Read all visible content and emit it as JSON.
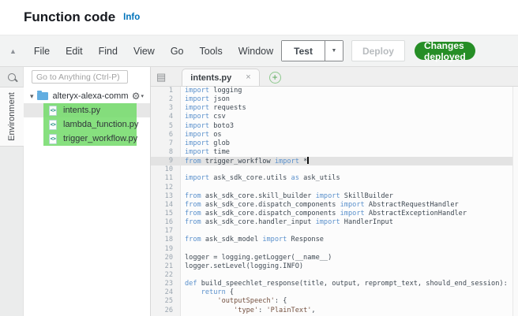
{
  "header": {
    "title": "Function code",
    "info_label": "Info"
  },
  "menubar": {
    "items": [
      "File",
      "Edit",
      "Find",
      "View",
      "Go",
      "Tools",
      "Window"
    ],
    "test_label": "Test",
    "deploy_label": "Deploy",
    "badge_label": "Changes deployed",
    "badge_color": "#268e26"
  },
  "sidebar": {
    "search_placeholder": "Go to Anything (Ctrl-P)",
    "rail_tab": "Environment",
    "tree": {
      "folder": "alteryx-alexa-comm",
      "files": [
        "intents.py",
        "lambda_function.py",
        "trigger_workflow.py"
      ],
      "selected_file": "intents.py",
      "highlight_color": "#72da68"
    }
  },
  "editor": {
    "tab": "intents.py",
    "active_line": 9,
    "cursor_line": 9,
    "code_lines": [
      "import logging",
      "import json",
      "import requests",
      "import csv",
      "import boto3",
      "import os",
      "import glob",
      "import time",
      "from trigger_workflow import *",
      "",
      "import ask_sdk_core.utils as ask_utils",
      "",
      "from ask_sdk_core.skill_builder import SkillBuilder",
      "from ask_sdk_core.dispatch_components import AbstractRequestHandler",
      "from ask_sdk_core.dispatch_components import AbstractExceptionHandler",
      "from ask_sdk_core.handler_input import HandlerInput",
      "",
      "from ask_sdk_model import Response",
      "",
      "logger = logging.getLogger(__name__)",
      "logger.setLevel(logging.INFO)",
      "",
      "def build_speechlet_response(title, output, reprompt_text, should_end_session):",
      "    return {",
      "        'outputSpeech': {",
      "            'type': 'PlainText',"
    ]
  },
  "icons": {
    "collapse_menu": "▲",
    "folder_caret": "▾",
    "gear": "⚙",
    "gear_caret": "▾",
    "file_code_glyph": "<>",
    "tab_list": "▤",
    "tab_close": "×",
    "add_tab": "+",
    "test_caret": "▼"
  },
  "colors": {
    "accent_link": "#0073bb",
    "keyword_blue": "#5b91cc",
    "active_line": "#e3e3e3"
  }
}
